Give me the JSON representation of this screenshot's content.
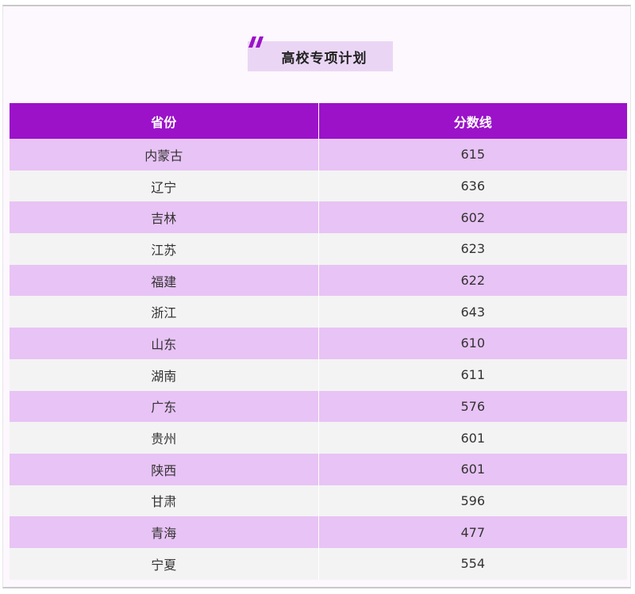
{
  "title": "高校专项计划",
  "colors": {
    "header_bg": "#9b12c9",
    "row_odd": "#e8c3f5",
    "row_even": "#f3f3f3",
    "title_bg": "#ead6f4",
    "accent_mark": "#9b12c9"
  },
  "table": {
    "headers": [
      "省份",
      "分数线"
    ],
    "rows": [
      {
        "province": "内蒙古",
        "score": "615"
      },
      {
        "province": "辽宁",
        "score": "636"
      },
      {
        "province": "吉林",
        "score": "602"
      },
      {
        "province": "江苏",
        "score": "623"
      },
      {
        "province": "福建",
        "score": "622"
      },
      {
        "province": "浙江",
        "score": "643"
      },
      {
        "province": "山东",
        "score": "610"
      },
      {
        "province": "湖南",
        "score": "611"
      },
      {
        "province": "广东",
        "score": "576"
      },
      {
        "province": "贵州",
        "score": "601"
      },
      {
        "province": "陕西",
        "score": "601"
      },
      {
        "province": "甘肃",
        "score": "596"
      },
      {
        "province": "青海",
        "score": "477"
      },
      {
        "province": "宁夏",
        "score": "554"
      }
    ]
  }
}
